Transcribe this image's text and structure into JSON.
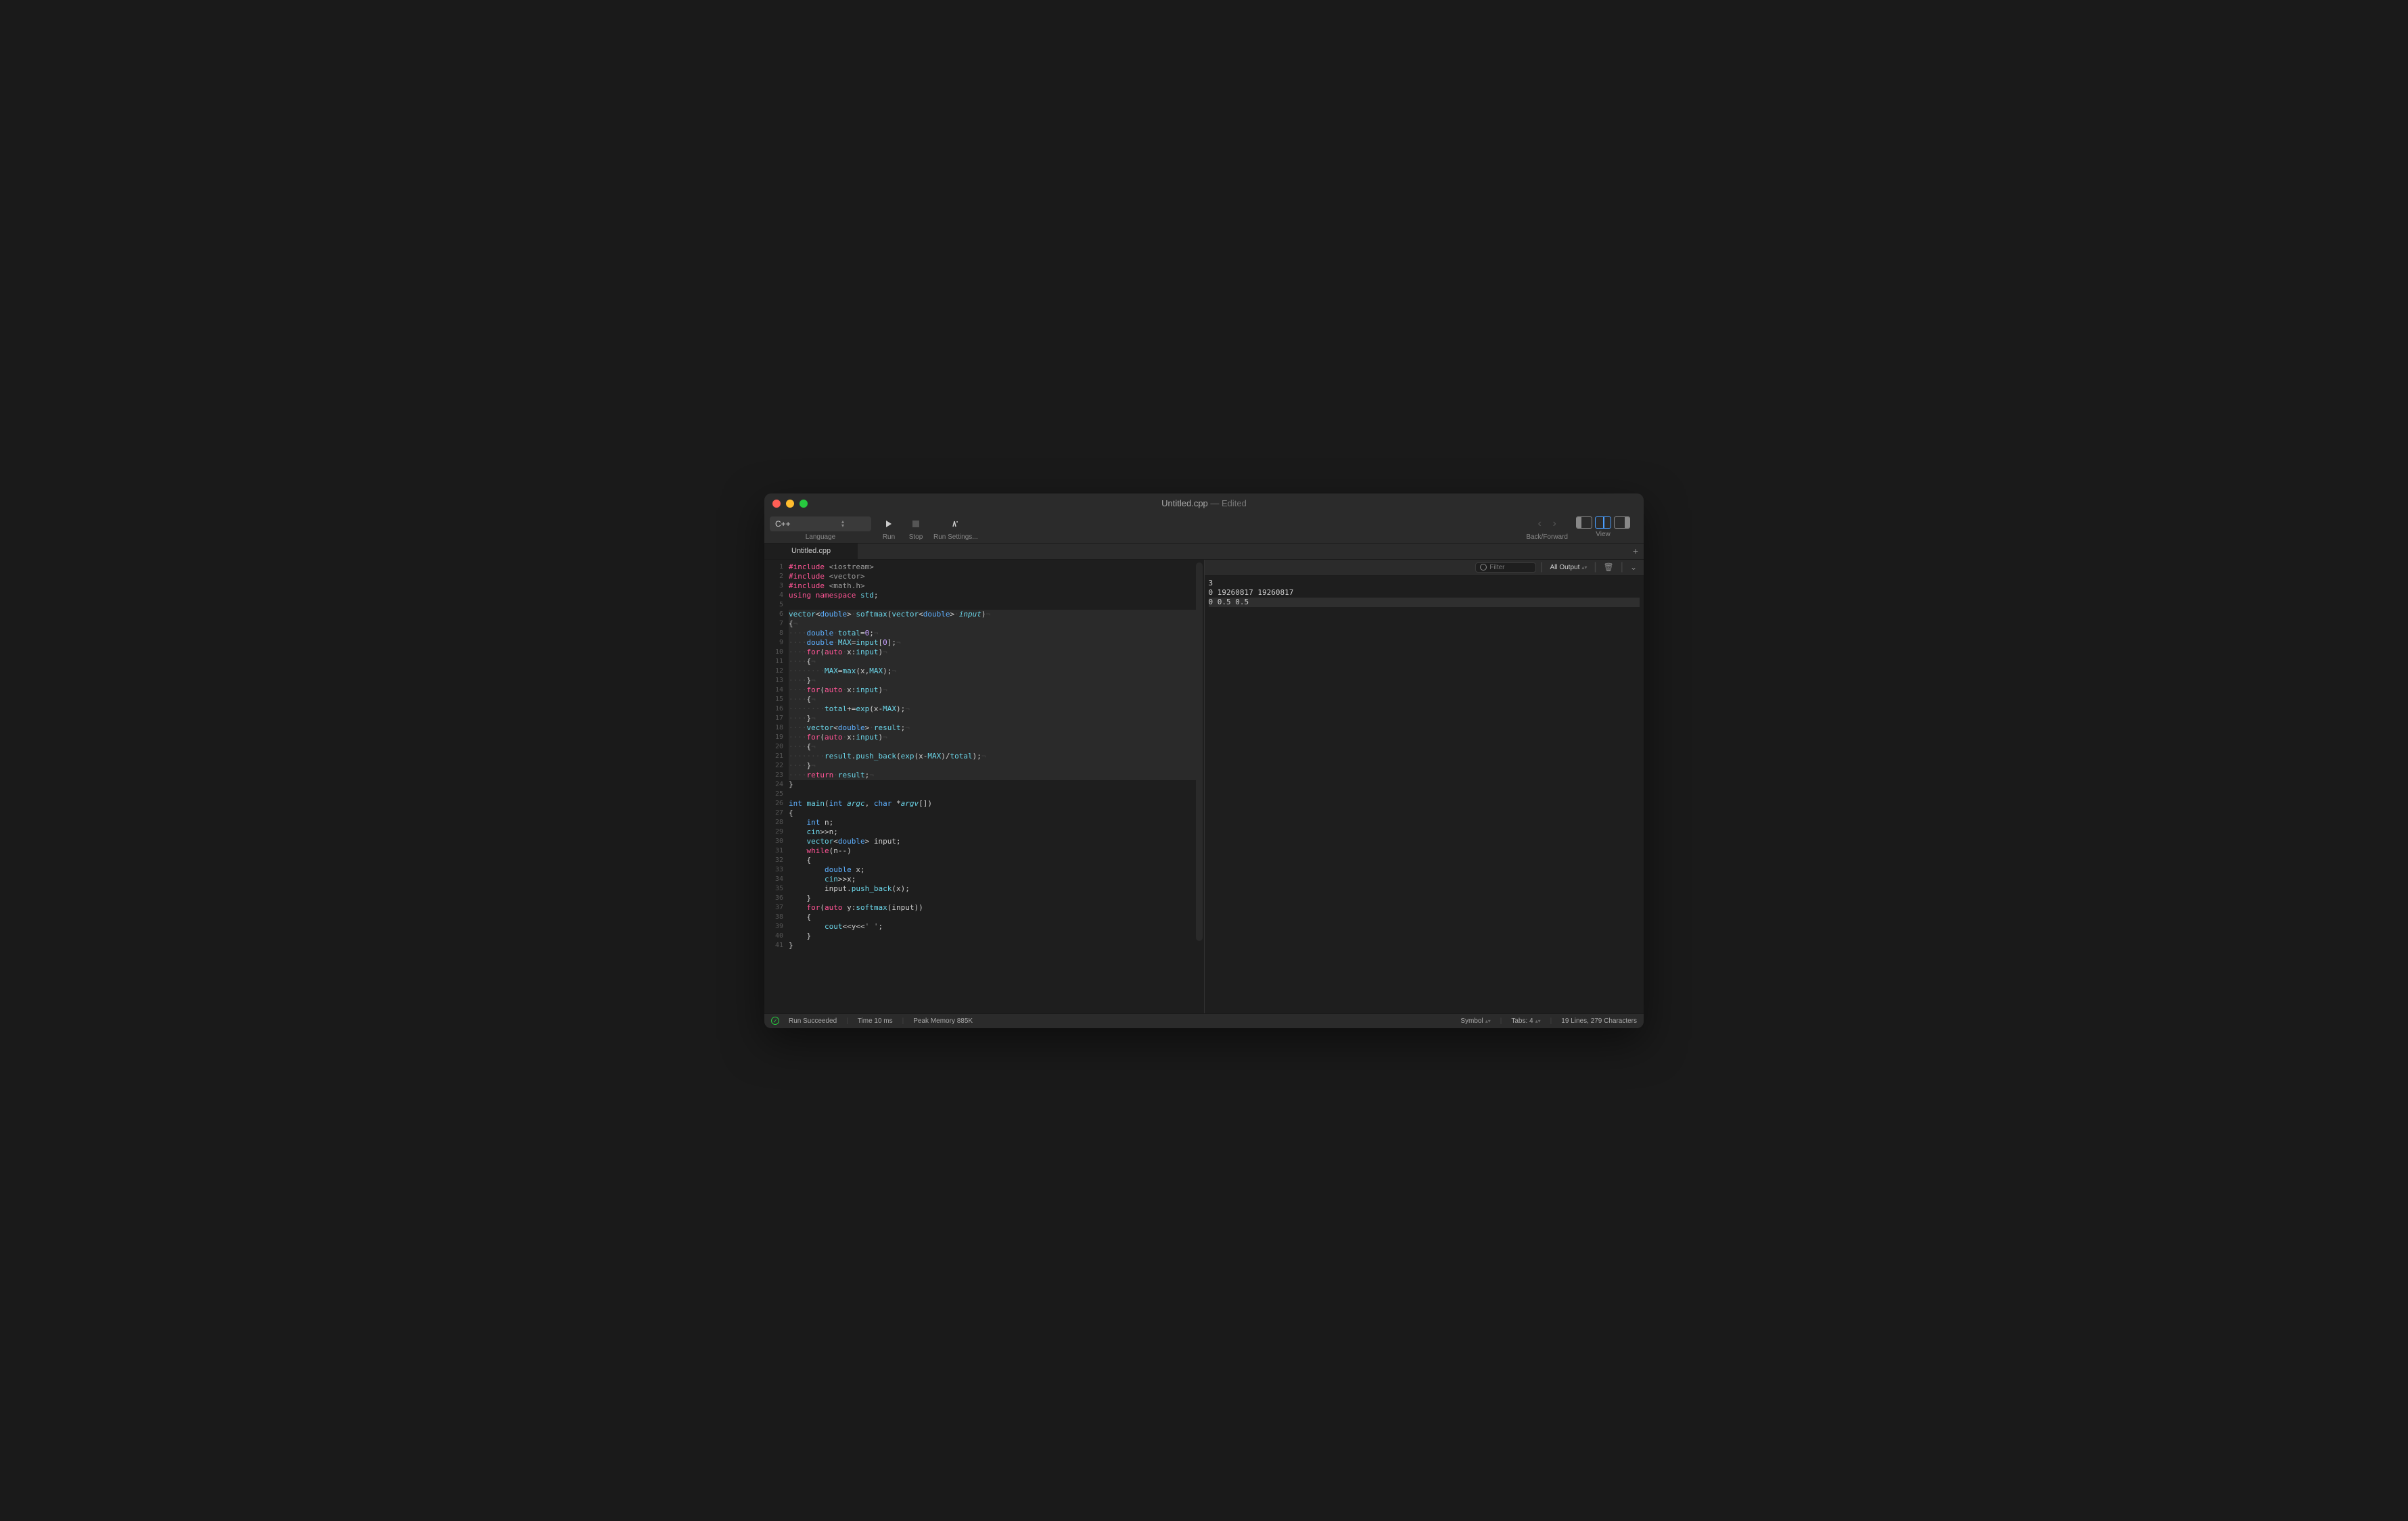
{
  "window": {
    "title": "Untitled.cpp",
    "title_suffix": " — Edited"
  },
  "toolbar": {
    "language": "C++",
    "language_label": "Language",
    "run_label": "Run",
    "stop_label": "Stop",
    "settings_label": "Run Settings...",
    "backforward_label": "Back/Forward",
    "view_label": "View"
  },
  "tab": {
    "name": "Untitled.cpp"
  },
  "code": {
    "lines": [
      {
        "n": 1,
        "html": "<span class='inc'>#include</span> <span class='str'>&lt;iostream&gt;</span>"
      },
      {
        "n": 2,
        "html": "<span class='inc'>#include</span> <span class='str'>&lt;vector&gt;</span>"
      },
      {
        "n": 3,
        "html": "<span class='inc'>#include</span> <span class='str'>&lt;math.h&gt;</span>"
      },
      {
        "n": 4,
        "html": "<span class='kw'>using</span> <span class='kw'>namespace</span> <span class='var'>std</span>;"
      },
      {
        "n": 5,
        "html": ""
      },
      {
        "n": 6,
        "html": "<span class='var'>vector</span>&lt;<span class='type2'>double</span>&gt;<span class='invis'>·</span><span class='fn'>softmax</span>(<span class='var'>vector</span>&lt;<span class='type2'>double</span>&gt;<span class='invis'>·</span><span class='param'>input</span>)<span class='invis'>¬</span>",
        "hl": true
      },
      {
        "n": 7,
        "html": "{<span class='invis'>¬</span>",
        "hl": true
      },
      {
        "n": 8,
        "html": "<span class='invis'>····</span><span class='type2'>double</span><span class='invis'>·</span><span class='var'>total</span>=<span class='num'>0</span>;<span class='invis'>¬</span>",
        "hl": true
      },
      {
        "n": 9,
        "html": "<span class='invis'>····</span><span class='type2'>double</span><span class='invis'>·</span><span class='var'>MAX</span>=<span class='var'>input</span>[<span class='num'>0</span>];<span class='invis'>¬</span>",
        "hl": true
      },
      {
        "n": 10,
        "html": "<span class='invis'>····</span><span class='kw'>for</span>(<span class='kw'>auto</span><span class='invis'>·</span>x:<span class='var'>input</span>)<span class='invis'>¬</span>",
        "hl": true
      },
      {
        "n": 11,
        "html": "<span class='invis'>····</span>{<span class='invis'>¬</span>",
        "hl": true
      },
      {
        "n": 12,
        "html": "<span class='invis'>········</span><span class='var'>MAX</span>=<span class='fn'>max</span>(x,<span class='var'>MAX</span>);<span class='invis'>¬</span>",
        "hl": true
      },
      {
        "n": 13,
        "html": "<span class='invis'>····</span>}<span class='invis'>¬</span>",
        "hl": true
      },
      {
        "n": 14,
        "html": "<span class='invis'>····</span><span class='kw'>for</span>(<span class='kw'>auto</span><span class='invis'>·</span>x:<span class='var'>input</span>)<span class='invis'>¬</span>",
        "hl": true
      },
      {
        "n": 15,
        "html": "<span class='invis'>····</span>{<span class='invis'>¬</span>",
        "hl": true
      },
      {
        "n": 16,
        "html": "<span class='invis'>········</span><span class='var'>total</span>+=<span class='fn'>exp</span>(x-<span class='var'>MAX</span>);<span class='invis'>¬</span>",
        "hl": true
      },
      {
        "n": 17,
        "html": "<span class='invis'>····</span>}<span class='invis'>¬</span>",
        "hl": true
      },
      {
        "n": 18,
        "html": "<span class='invis'>····</span><span class='var'>vector</span>&lt;<span class='type2'>double</span>&gt;<span class='invis'>·</span><span class='var'>result</span>;<span class='invis'>¬</span>",
        "hl": true
      },
      {
        "n": 19,
        "html": "<span class='invis'>····</span><span class='kw'>for</span>(<span class='kw'>auto</span><span class='invis'>·</span>x:<span class='var'>input</span>)<span class='invis'>¬</span>",
        "hl": true
      },
      {
        "n": 20,
        "html": "<span class='invis'>····</span>{<span class='invis'>¬</span>",
        "hl": true
      },
      {
        "n": 21,
        "html": "<span class='invis'>········</span><span class='var'>result</span>.<span class='fn'>push_back</span>(<span class='fn'>exp</span>(x-<span class='var'>MAX</span>)/<span class='var'>total</span>);<span class='invis'>¬</span>",
        "hl": true
      },
      {
        "n": 22,
        "html": "<span class='invis'>····</span>}<span class='invis'>¬</span>",
        "hl": true
      },
      {
        "n": 23,
        "html": "<span class='invis'>····</span><span class='kw'>return</span><span class='invis'>·</span><span class='var'>result</span>;<span class='invis'>¬</span>",
        "hl": true
      },
      {
        "n": 24,
        "html": "}"
      },
      {
        "n": 25,
        "html": ""
      },
      {
        "n": 26,
        "html": "<span class='type2'>int</span> <span class='fn'>main</span>(<span class='type2'>int</span> <span class='param'>argc</span>, <span class='type2'>char</span> *<span class='param'>argv</span>[])"
      },
      {
        "n": 27,
        "html": "{"
      },
      {
        "n": 28,
        "html": "    <span class='type2'>int</span> n;"
      },
      {
        "n": 29,
        "html": "    <span class='var'>cin</span>&gt;&gt;n;"
      },
      {
        "n": 30,
        "html": "    <span class='var'>vector</span>&lt;<span class='type2'>double</span>&gt; input;"
      },
      {
        "n": 31,
        "html": "    <span class='kw'>while</span>(n--)"
      },
      {
        "n": 32,
        "html": "    {"
      },
      {
        "n": 33,
        "html": "        <span class='type2'>double</span> x;"
      },
      {
        "n": 34,
        "html": "        <span class='var'>cin</span>&gt;&gt;x;"
      },
      {
        "n": 35,
        "html": "        input.<span class='fn'>push_back</span>(x);"
      },
      {
        "n": 36,
        "html": "    }"
      },
      {
        "n": 37,
        "html": "    <span class='kw'>for</span>(<span class='kw'>auto</span> y:<span class='fn'>softmax</span>(input))"
      },
      {
        "n": 38,
        "html": "    {"
      },
      {
        "n": 39,
        "html": "        <span class='var'>cout</span>&lt;&lt;y&lt;&lt;<span class='str'>' '</span>;"
      },
      {
        "n": 40,
        "html": "    }"
      },
      {
        "n": 41,
        "html": "}"
      }
    ]
  },
  "output": {
    "filter_placeholder": "Filter",
    "mode": "All Output",
    "lines": [
      {
        "text": "3",
        "hl": false
      },
      {
        "text": "0 19260817 19260817",
        "hl": false
      },
      {
        "text": "0 0.5 0.5 ",
        "hl": true
      }
    ]
  },
  "status": {
    "run": "Run Succeeded",
    "time": "Time 10 ms",
    "mem": "Peak Memory 885K",
    "symbol": "Symbol",
    "tabs": "Tabs: 4",
    "lines": "19 Lines, 279 Characters"
  }
}
